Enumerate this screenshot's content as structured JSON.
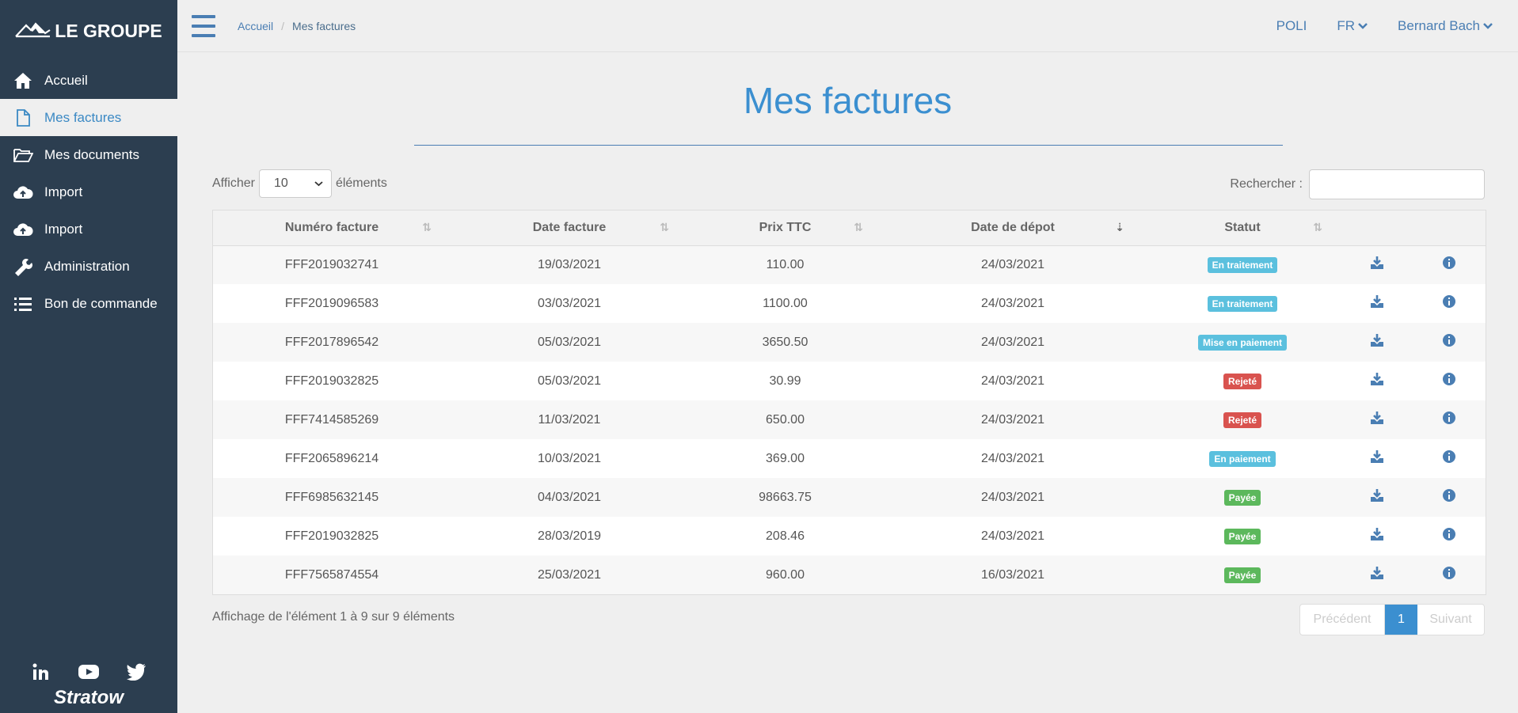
{
  "brand": {
    "logo_text": "LE GROUPE",
    "footer_logo": "Stratow"
  },
  "sidebar": {
    "items": [
      {
        "label": "Accueil",
        "icon": "home-icon",
        "active": false
      },
      {
        "label": "Mes factures",
        "icon": "file-icon",
        "active": true
      },
      {
        "label": "Mes documents",
        "icon": "folder-open-icon",
        "active": false
      },
      {
        "label": "Import",
        "icon": "cloud-upload-icon",
        "active": false
      },
      {
        "label": "Import",
        "icon": "cloud-upload-icon",
        "active": false
      },
      {
        "label": "Administration",
        "icon": "wrench-icon",
        "active": false
      },
      {
        "label": "Bon de commande",
        "icon": "list-icon",
        "active": false
      }
    ],
    "social": [
      "linkedin-icon",
      "youtube-icon",
      "twitter-icon"
    ]
  },
  "topbar": {
    "breadcrumb": {
      "home": "Accueil",
      "separator": "/",
      "current": "Mes factures"
    },
    "org": "POLI",
    "language": "FR",
    "user": "Bernard Bach"
  },
  "page": {
    "title": "Mes factures"
  },
  "controls": {
    "show_label": "Afficher",
    "page_size": "10",
    "elements_label": "éléments",
    "search_label": "Rechercher :",
    "search_value": ""
  },
  "table": {
    "columns": [
      "Numéro facture",
      "Date facture",
      "Prix TTC",
      "Date de dépot",
      "Statut"
    ],
    "rows": [
      {
        "numero": "FFF2019032741",
        "date": "19/03/2021",
        "prix": "110.00",
        "depot": "24/03/2021",
        "statut": "En traitement",
        "statut_color": "#5bc0de"
      },
      {
        "numero": "FFF2019096583",
        "date": "03/03/2021",
        "prix": "1100.00",
        "depot": "24/03/2021",
        "statut": "En traitement",
        "statut_color": "#5bc0de"
      },
      {
        "numero": "FFF2017896542",
        "date": "05/03/2021",
        "prix": "3650.50",
        "depot": "24/03/2021",
        "statut": "Mise en paiement",
        "statut_color": "#5bc0de"
      },
      {
        "numero": "FFF2019032825",
        "date": "05/03/2021",
        "prix": "30.99",
        "depot": "24/03/2021",
        "statut": "Rejeté",
        "statut_color": "#d9534f"
      },
      {
        "numero": "FFF7414585269",
        "date": "11/03/2021",
        "prix": "650.00",
        "depot": "24/03/2021",
        "statut": "Rejeté",
        "statut_color": "#d9534f"
      },
      {
        "numero": "FFF2065896214",
        "date": "10/03/2021",
        "prix": "369.00",
        "depot": "24/03/2021",
        "statut": "En paiement",
        "statut_color": "#5bc0de"
      },
      {
        "numero": "FFF6985632145",
        "date": "04/03/2021",
        "prix": "98663.75",
        "depot": "24/03/2021",
        "statut": "Payée",
        "statut_color": "#5cb85c"
      },
      {
        "numero": "FFF2019032825",
        "date": "28/03/2019",
        "prix": "208.46",
        "depot": "24/03/2021",
        "statut": "Payée",
        "statut_color": "#5cb85c"
      },
      {
        "numero": "FFF7565874554",
        "date": "25/03/2021",
        "prix": "960.00",
        "depot": "16/03/2021",
        "statut": "Payée",
        "statut_color": "#5cb85c"
      }
    ]
  },
  "footer": {
    "info": "Affichage de l'élément 1 à 9 sur 9 éléments",
    "prev": "Précédent",
    "page": "1",
    "next": "Suivant"
  }
}
